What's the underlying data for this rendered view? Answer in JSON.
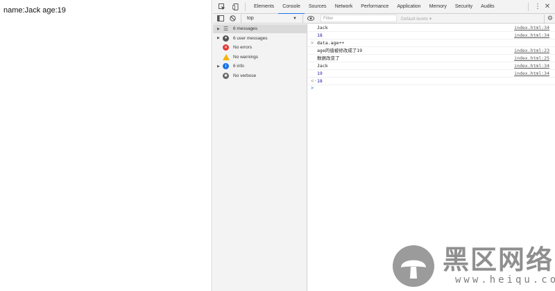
{
  "page": {
    "text": "name:Jack age:19"
  },
  "devtools": {
    "tabs": [
      "Elements",
      "Console",
      "Sources",
      "Network",
      "Performance",
      "Application",
      "Memory",
      "Security",
      "Audits"
    ],
    "active_tab": "Console",
    "accent_color": "#1a73e8",
    "toolbar": {
      "context": "top",
      "filter_placeholder": "Filter",
      "levels_label": "Default levels ▾"
    },
    "sidebar": {
      "items": [
        {
          "label": "6 messages",
          "icon": "list-icon",
          "expandable": true,
          "selected": true
        },
        {
          "label": "6 user messages",
          "icon": "user-icon",
          "expandable": true,
          "selected": false
        },
        {
          "label": "No errors",
          "icon": "error-icon",
          "expandable": false,
          "selected": false
        },
        {
          "label": "No warnings",
          "icon": "warning-icon",
          "expandable": false,
          "selected": false
        },
        {
          "label": "6 info",
          "icon": "info-icon",
          "expandable": true,
          "selected": false
        },
        {
          "label": "No verbose",
          "icon": "verbose-icon",
          "expandable": false,
          "selected": false
        }
      ]
    },
    "console": {
      "lines": [
        {
          "text": "Jack",
          "source": "index.html:34",
          "kind": "log"
        },
        {
          "text": "18",
          "source": "index.html:34",
          "kind": "num"
        },
        {
          "text": "data.age++",
          "source": "",
          "kind": "input",
          "prefix": ">"
        },
        {
          "text": "age的值被修改成了19",
          "source": "index.html:23",
          "kind": "log"
        },
        {
          "text": "数据改变了",
          "source": "index.html:25",
          "kind": "log"
        },
        {
          "text": "Jack",
          "source": "index.html:34",
          "kind": "log"
        },
        {
          "text": "19",
          "source": "index.html:34",
          "kind": "num"
        },
        {
          "text": "18",
          "source": "",
          "kind": "result",
          "prefix": "<·"
        }
      ],
      "prompt": ">"
    }
  },
  "watermark": {
    "title": "黑区网络",
    "url": "www.heiqu.com"
  }
}
